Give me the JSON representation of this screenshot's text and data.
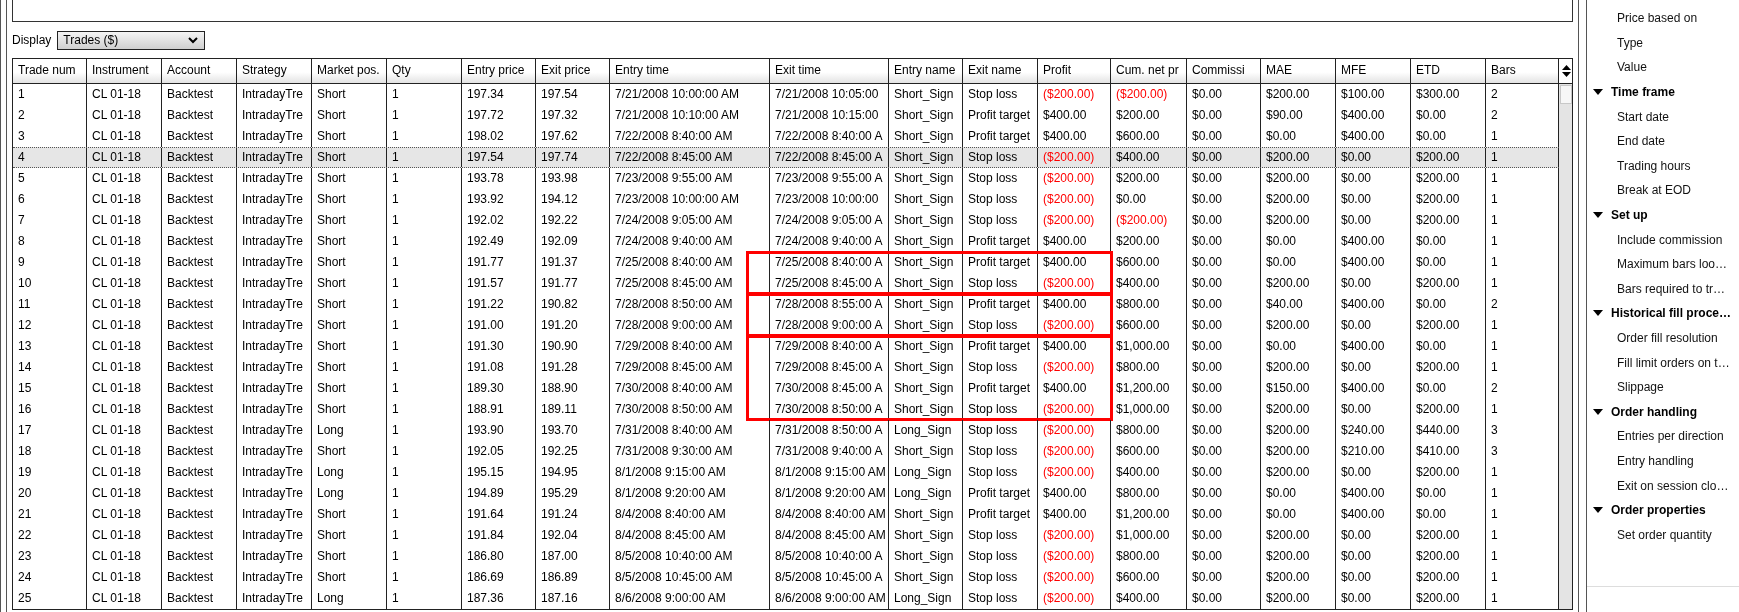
{
  "display": {
    "label": "Display",
    "value": "Trades ($)"
  },
  "table": {
    "columns": [
      "Trade num",
      "Instrument",
      "Account",
      "Strategy",
      "Market pos.",
      "Qty",
      "Entry price",
      "Exit price",
      "Entry time",
      "Exit time",
      "Entry name",
      "Exit name",
      "Profit",
      "Cum. net pr",
      "Commissi",
      "MAE",
      "MFE",
      "ETD",
      "Bars"
    ],
    "groups": [
      {
        "outlined": false,
        "rows": [
          {
            "cells": [
              "1",
              "CL 01-18",
              "Backtest",
              "IntradayTre",
              "Short",
              "1",
              "197.34",
              "197.54",
              "7/21/2008 10:00:00 AM",
              "7/21/2008 10:05:00",
              "Short_Sign",
              "Stop loss",
              "($200.00)",
              "($200.00)",
              "$0.00",
              "$200.00",
              "$100.00",
              "$300.00",
              "2"
            ],
            "selected": false,
            "profit_loss": true,
            "cum_loss": true
          },
          {
            "cells": [
              "2",
              "CL 01-18",
              "Backtest",
              "IntradayTre",
              "Short",
              "1",
              "197.72",
              "197.32",
              "7/21/2008 10:10:00 AM",
              "7/21/2008 10:15:00",
              "Short_Sign",
              "Profit target",
              "$400.00",
              "$200.00",
              "$0.00",
              "$90.00",
              "$400.00",
              "$0.00",
              "2"
            ],
            "selected": false,
            "profit_loss": false,
            "cum_loss": false
          },
          {
            "cells": [
              "3",
              "CL 01-18",
              "Backtest",
              "IntradayTre",
              "Short",
              "1",
              "198.02",
              "197.62",
              "7/22/2008 8:40:00 AM",
              "7/22/2008 8:40:00 A",
              "Short_Sign",
              "Profit target",
              "$400.00",
              "$600.00",
              "$0.00",
              "$0.00",
              "$400.00",
              "$0.00",
              "1"
            ],
            "selected": false,
            "profit_loss": false,
            "cum_loss": false
          },
          {
            "cells": [
              "4",
              "CL 01-18",
              "Backtest",
              "IntradayTre",
              "Short",
              "1",
              "197.54",
              "197.74",
              "7/22/2008 8:45:00 AM",
              "7/22/2008 8:45:00 A",
              "Short_Sign",
              "Stop loss",
              "($200.00)",
              "$400.00",
              "$0.00",
              "$200.00",
              "$0.00",
              "$200.00",
              "1"
            ],
            "selected": true,
            "profit_loss": true,
            "cum_loss": false
          },
          {
            "cells": [
              "5",
              "CL 01-18",
              "Backtest",
              "IntradayTre",
              "Short",
              "1",
              "193.78",
              "193.98",
              "7/23/2008 9:55:00 AM",
              "7/23/2008 9:55:00 A",
              "Short_Sign",
              "Stop loss",
              "($200.00)",
              "$200.00",
              "$0.00",
              "$200.00",
              "$0.00",
              "$200.00",
              "1"
            ],
            "selected": false,
            "profit_loss": true,
            "cum_loss": false
          },
          {
            "cells": [
              "6",
              "CL 01-18",
              "Backtest",
              "IntradayTre",
              "Short",
              "1",
              "193.92",
              "194.12",
              "7/23/2008 10:00:00 AM",
              "7/23/2008 10:00:00",
              "Short_Sign",
              "Stop loss",
              "($200.00)",
              "$0.00",
              "$0.00",
              "$200.00",
              "$0.00",
              "$200.00",
              "1"
            ],
            "selected": false,
            "profit_loss": true,
            "cum_loss": false
          },
          {
            "cells": [
              "7",
              "CL 01-18",
              "Backtest",
              "IntradayTre",
              "Short",
              "1",
              "192.02",
              "192.22",
              "7/24/2008 9:05:00 AM",
              "7/24/2008 9:05:00 A",
              "Short_Sign",
              "Stop loss",
              "($200.00)",
              "($200.00)",
              "$0.00",
              "$200.00",
              "$0.00",
              "$200.00",
              "1"
            ],
            "selected": false,
            "profit_loss": true,
            "cum_loss": true
          },
          {
            "cells": [
              "8",
              "CL 01-18",
              "Backtest",
              "IntradayTre",
              "Short",
              "1",
              "192.49",
              "192.09",
              "7/24/2008 9:40:00 AM",
              "7/24/2008 9:40:00 A",
              "Short_Sign",
              "Profit target",
              "$400.00",
              "$200.00",
              "$0.00",
              "$0.00",
              "$400.00",
              "$0.00",
              "1"
            ],
            "selected": false,
            "profit_loss": false,
            "cum_loss": false
          }
        ]
      },
      {
        "outlined": true,
        "rows": [
          {
            "cells": [
              "9",
              "CL 01-18",
              "Backtest",
              "IntradayTre",
              "Short",
              "1",
              "191.77",
              "191.37",
              "7/25/2008 8:40:00 AM",
              "7/25/2008 8:40:00 A",
              "Short_Sign",
              "Profit target",
              "$400.00",
              "$600.00",
              "$0.00",
              "$0.00",
              "$400.00",
              "$0.00",
              "1"
            ],
            "selected": false,
            "profit_loss": false,
            "cum_loss": false
          },
          {
            "cells": [
              "10",
              "CL 01-18",
              "Backtest",
              "IntradayTre",
              "Short",
              "1",
              "191.57",
              "191.77",
              "7/25/2008 8:45:00 AM",
              "7/25/2008 8:45:00 A",
              "Short_Sign",
              "Stop loss",
              "($200.00)",
              "$400.00",
              "$0.00",
              "$200.00",
              "$0.00",
              "$200.00",
              "1"
            ],
            "selected": false,
            "profit_loss": true,
            "cum_loss": false
          }
        ]
      },
      {
        "outlined": true,
        "rows": [
          {
            "cells": [
              "11",
              "CL 01-18",
              "Backtest",
              "IntradayTre",
              "Short",
              "1",
              "191.22",
              "190.82",
              "7/28/2008 8:50:00 AM",
              "7/28/2008 8:55:00 A",
              "Short_Sign",
              "Profit target",
              "$400.00",
              "$800.00",
              "$0.00",
              "$40.00",
              "$400.00",
              "$0.00",
              "2"
            ],
            "selected": false,
            "profit_loss": false,
            "cum_loss": false
          },
          {
            "cells": [
              "12",
              "CL 01-18",
              "Backtest",
              "IntradayTre",
              "Short",
              "1",
              "191.00",
              "191.20",
              "7/28/2008 9:00:00 AM",
              "7/28/2008 9:00:00 A",
              "Short_Sign",
              "Stop loss",
              "($200.00)",
              "$600.00",
              "$0.00",
              "$200.00",
              "$0.00",
              "$200.00",
              "1"
            ],
            "selected": false,
            "profit_loss": true,
            "cum_loss": false
          }
        ]
      },
      {
        "outlined": true,
        "rows": [
          {
            "cells": [
              "13",
              "CL 01-18",
              "Backtest",
              "IntradayTre",
              "Short",
              "1",
              "191.30",
              "190.90",
              "7/29/2008 8:40:00 AM",
              "7/29/2008 8:40:00 A",
              "Short_Sign",
              "Profit target",
              "$400.00",
              "$1,000.00",
              "$0.00",
              "$0.00",
              "$400.00",
              "$0.00",
              "1"
            ],
            "selected": false,
            "profit_loss": false,
            "cum_loss": false
          },
          {
            "cells": [
              "14",
              "CL 01-18",
              "Backtest",
              "IntradayTre",
              "Short",
              "1",
              "191.08",
              "191.28",
              "7/29/2008 8:45:00 AM",
              "7/29/2008 8:45:00 A",
              "Short_Sign",
              "Stop loss",
              "($200.00)",
              "$800.00",
              "$0.00",
              "$200.00",
              "$0.00",
              "$200.00",
              "1"
            ],
            "selected": false,
            "profit_loss": true,
            "cum_loss": false
          },
          {
            "cells": [
              "15",
              "CL 01-18",
              "Backtest",
              "IntradayTre",
              "Short",
              "1",
              "189.30",
              "188.90",
              "7/30/2008 8:40:00 AM",
              "7/30/2008 8:45:00 A",
              "Short_Sign",
              "Profit target",
              "$400.00",
              "$1,200.00",
              "$0.00",
              "$150.00",
              "$400.00",
              "$0.00",
              "2"
            ],
            "selected": false,
            "profit_loss": false,
            "cum_loss": false
          },
          {
            "cells": [
              "16",
              "CL 01-18",
              "Backtest",
              "IntradayTre",
              "Short",
              "1",
              "188.91",
              "189.11",
              "7/30/2008 8:50:00 AM",
              "7/30/2008 8:50:00 A",
              "Short_Sign",
              "Stop loss",
              "($200.00)",
              "$1,000.00",
              "$0.00",
              "$200.00",
              "$0.00",
              "$200.00",
              "1"
            ],
            "selected": false,
            "profit_loss": true,
            "cum_loss": false
          }
        ]
      },
      {
        "outlined": false,
        "rows": [
          {
            "cells": [
              "17",
              "CL 01-18",
              "Backtest",
              "IntradayTre",
              "Long",
              "1",
              "193.90",
              "193.70",
              "7/31/2008 8:40:00 AM",
              "7/31/2008 8:50:00 A",
              "Long_Sign",
              "Stop loss",
              "($200.00)",
              "$800.00",
              "$0.00",
              "$200.00",
              "$240.00",
              "$440.00",
              "3"
            ],
            "selected": false,
            "profit_loss": true,
            "cum_loss": false
          },
          {
            "cells": [
              "18",
              "CL 01-18",
              "Backtest",
              "IntradayTre",
              "Short",
              "1",
              "192.05",
              "192.25",
              "7/31/2008 9:30:00 AM",
              "7/31/2008 9:40:00 A",
              "Short_Sign",
              "Stop loss",
              "($200.00)",
              "$600.00",
              "$0.00",
              "$200.00",
              "$210.00",
              "$410.00",
              "3"
            ],
            "selected": false,
            "profit_loss": true,
            "cum_loss": false
          },
          {
            "cells": [
              "19",
              "CL 01-18",
              "Backtest",
              "IntradayTre",
              "Long",
              "1",
              "195.15",
              "194.95",
              "8/1/2008 9:15:00 AM",
              "8/1/2008 9:15:00 AM",
              "Long_Sign",
              "Stop loss",
              "($200.00)",
              "$400.00",
              "$0.00",
              "$200.00",
              "$0.00",
              "$200.00",
              "1"
            ],
            "selected": false,
            "profit_loss": true,
            "cum_loss": false
          },
          {
            "cells": [
              "20",
              "CL 01-18",
              "Backtest",
              "IntradayTre",
              "Long",
              "1",
              "194.89",
              "195.29",
              "8/1/2008 9:20:00 AM",
              "8/1/2008 9:20:00 AM",
              "Long_Sign",
              "Profit target",
              "$400.00",
              "$800.00",
              "$0.00",
              "$0.00",
              "$400.00",
              "$0.00",
              "1"
            ],
            "selected": false,
            "profit_loss": false,
            "cum_loss": false
          },
          {
            "cells": [
              "21",
              "CL 01-18",
              "Backtest",
              "IntradayTre",
              "Short",
              "1",
              "191.64",
              "191.24",
              "8/4/2008 8:40:00 AM",
              "8/4/2008 8:40:00 AM",
              "Short_Sign",
              "Profit target",
              "$400.00",
              "$1,200.00",
              "$0.00",
              "$0.00",
              "$400.00",
              "$0.00",
              "1"
            ],
            "selected": false,
            "profit_loss": false,
            "cum_loss": false
          },
          {
            "cells": [
              "22",
              "CL 01-18",
              "Backtest",
              "IntradayTre",
              "Short",
              "1",
              "191.84",
              "192.04",
              "8/4/2008 8:45:00 AM",
              "8/4/2008 8:45:00 AM",
              "Short_Sign",
              "Stop loss",
              "($200.00)",
              "$1,000.00",
              "$0.00",
              "$200.00",
              "$0.00",
              "$200.00",
              "1"
            ],
            "selected": false,
            "profit_loss": true,
            "cum_loss": false
          },
          {
            "cells": [
              "23",
              "CL 01-18",
              "Backtest",
              "IntradayTre",
              "Short",
              "1",
              "186.80",
              "187.00",
              "8/5/2008 10:40:00 AM",
              "8/5/2008 10:40:00 A",
              "Short_Sign",
              "Stop loss",
              "($200.00)",
              "$800.00",
              "$0.00",
              "$200.00",
              "$0.00",
              "$200.00",
              "1"
            ],
            "selected": false,
            "profit_loss": true,
            "cum_loss": false
          },
          {
            "cells": [
              "24",
              "CL 01-18",
              "Backtest",
              "IntradayTre",
              "Short",
              "1",
              "186.69",
              "186.89",
              "8/5/2008 10:45:00 AM",
              "8/5/2008 10:45:00 A",
              "Short_Sign",
              "Stop loss",
              "($200.00)",
              "$600.00",
              "$0.00",
              "$200.00",
              "$0.00",
              "$200.00",
              "1"
            ],
            "selected": false,
            "profit_loss": true,
            "cum_loss": false
          },
          {
            "cells": [
              "25",
              "CL 01-18",
              "Backtest",
              "IntradayTre",
              "Long",
              "1",
              "187.36",
              "187.16",
              "8/6/2008 9:00:00 AM",
              "8/6/2008 9:00:00 AM",
              "Long_Sign",
              "Stop loss",
              "($200.00)",
              "$400.00",
              "$0.00",
              "$200.00",
              "$0.00",
              "$200.00",
              "1"
            ],
            "selected": false,
            "profit_loss": true,
            "cum_loss": false
          }
        ]
      }
    ]
  },
  "properties": {
    "items": [
      "Price based on",
      "Type",
      "Value"
    ],
    "categories": [
      {
        "label": "Time frame",
        "expanded": true,
        "items": [
          "Start date",
          "End date",
          "Trading hours",
          "Break at EOD"
        ]
      },
      {
        "label": "Set up",
        "expanded": true,
        "items": [
          "Include commission",
          "Maximum bars loo…",
          "Bars required to tr…"
        ]
      },
      {
        "label": "Historical fill proce…",
        "expanded": true,
        "items": [
          "Order fill resolution",
          "Fill limit orders on t…",
          "Slippage"
        ]
      },
      {
        "label": "Order handling",
        "expanded": true,
        "items": [
          "Entries per direction",
          "Entry handling",
          "Exit on session clo…"
        ]
      },
      {
        "label": "Order properties",
        "expanded": true,
        "items": [
          "Set order quantity"
        ]
      }
    ]
  }
}
